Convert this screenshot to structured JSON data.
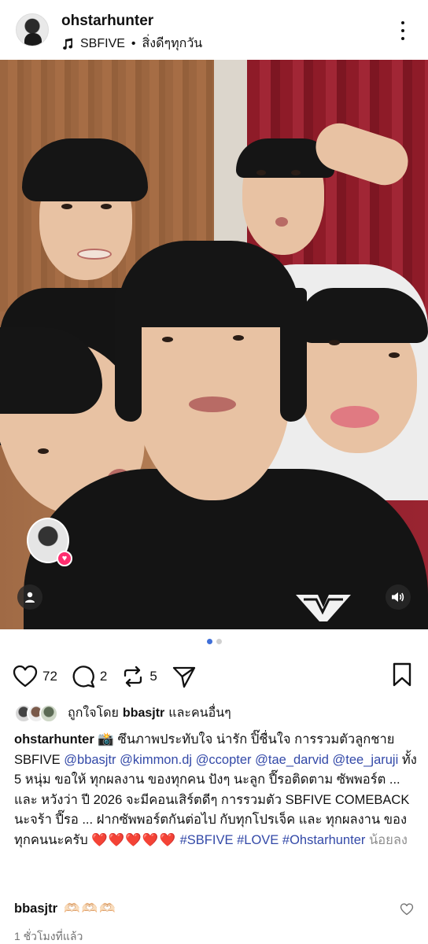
{
  "header": {
    "username": "ohstarhunter",
    "music_artist": "SBFIVE",
    "music_separator": "•",
    "music_title": "สิ่งดีๆทุกวัน"
  },
  "photo": {
    "carousel_total": 2,
    "carousel_active_index": 0
  },
  "actions": {
    "like_count": "72",
    "comment_count": "2",
    "repost_count": "5"
  },
  "likes": {
    "prefix": "ถูกใจโดย",
    "user": "bbasjtr",
    "suffix": "และคนอื่นๆ"
  },
  "caption": {
    "user": "ohstarhunter",
    "emoji": "📸",
    "text_1": "ซึนภาพประทับใจ น่ารัก ปิ๊ชื่นใจ การรวมตัวลูกชาย SBFIVE",
    "mention_1": "@bbasjtr",
    "mention_2": "@kimmon.dj",
    "mention_3": "@ccopter",
    "mention_4": "@tae_darvid",
    "mention_5": "@tee_jaruji",
    "text_2": "ทั้ง 5 หนุ่ม ขอให้ ทุกผลงาน ของทุกคน ปังๆ นะลูก ปี๊รอติดตาม ซัพพอร์ต ... และ หวังว่า ปี 2026 จะมีคอนเสิร์ตดีๆ การรวมตัว SBFIVE COMEBACK  นะจร้า ปี๊รอ ... ฝากซัพพอร์ตกันต่อไป กับทุกโปรเจ็ค และ ทุกผลงาน ของทุกคนนะครับ",
    "hearts": "❤️❤️❤️❤️❤️",
    "hashtag_1": "#SBFIVE",
    "hashtag_2": "#LOVE",
    "hashtag_3": "#Ohstarhunter",
    "more_label": "น้อยลง"
  },
  "comment": {
    "user": "bbasjtr",
    "text": "🫶🏻🫶🏻🫶🏻"
  },
  "timestamp": "1 ชั่วโมงที่แล้ว",
  "colors": {
    "mention": "#3349a8",
    "carousel_active": "#3f6fd8",
    "heart": "#e0202f",
    "tag_heart": "#ff2d6f"
  },
  "icons": [
    "music-note-icon",
    "more-vertical-icon",
    "user-tag-icon",
    "volume-icon",
    "heart-icon",
    "comment-icon",
    "repost-icon",
    "share-icon",
    "bookmark-icon"
  ]
}
